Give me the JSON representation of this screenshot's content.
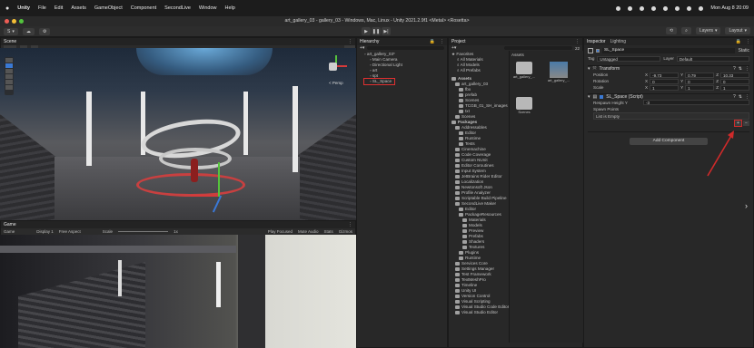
{
  "macos": {
    "app": "Unity",
    "menus": [
      "File",
      "Edit",
      "Assets",
      "GameObject",
      "Component",
      "SecondLive",
      "Window",
      "Help"
    ],
    "clock": "Mon Aug 8 20:09"
  },
  "window": {
    "title": "art_gallery_03 - gallery_03 - Windows, Mac, Linux - Unity 2021.2.9f1 <Metal> <Rosetta>"
  },
  "toolbar": {
    "account": "S",
    "layers": "Layers",
    "layout": "Layout"
  },
  "scene": {
    "tab": "Scene",
    "persp": "< Persp"
  },
  "game": {
    "tab": "Game",
    "mode": "Game",
    "display": "Display 1",
    "aspect": "Free Aspect",
    "scale_label": "Scale",
    "scale_value": "1x",
    "play_focused": "Play Focused",
    "mute": "Mute Audio",
    "stats": "Stats",
    "gizmos": "Gizmos"
  },
  "hierarchy": {
    "tab": "Hierarchy",
    "items": [
      {
        "label": "art_gallery_03*",
        "indent": 0
      },
      {
        "label": "Main Camera",
        "indent": 1
      },
      {
        "label": "Directional Light",
        "indent": 1
      },
      {
        "label": "art",
        "indent": 1
      },
      {
        "label": "spt",
        "indent": 1
      },
      {
        "label": "SL_Space",
        "indent": 1,
        "selected": true
      }
    ]
  },
  "project": {
    "tab": "Project",
    "favorites": {
      "label": "Favorites",
      "items": [
        "All Materials",
        "All Models",
        "All Prefabs"
      ]
    },
    "tree": [
      {
        "label": "Assets",
        "indent": 0,
        "bold": true
      },
      {
        "label": "art_gallery_03",
        "indent": 1
      },
      {
        "label": "fbx",
        "indent": 2
      },
      {
        "label": "prefab",
        "indent": 2
      },
      {
        "label": "Scenes",
        "indent": 2
      },
      {
        "label": "TCGB_01_SH_images",
        "indent": 2
      },
      {
        "label": "txt",
        "indent": 2
      },
      {
        "label": "Scenes",
        "indent": 1
      },
      {
        "label": "Packages",
        "indent": 0,
        "bold": true
      },
      {
        "label": "Addressables",
        "indent": 1
      },
      {
        "label": "Editor",
        "indent": 2
      },
      {
        "label": "Runtime",
        "indent": 2
      },
      {
        "label": "Tests",
        "indent": 2
      },
      {
        "label": "Cinemachine",
        "indent": 1
      },
      {
        "label": "Code Coverage",
        "indent": 1
      },
      {
        "label": "Custom NUnit",
        "indent": 1
      },
      {
        "label": "Editor Coroutines",
        "indent": 1
      },
      {
        "label": "Input System",
        "indent": 1
      },
      {
        "label": "JetBrains Rider Editor",
        "indent": 1
      },
      {
        "label": "Localization",
        "indent": 1
      },
      {
        "label": "Newtonsoft Json",
        "indent": 1
      },
      {
        "label": "Profile Analyzer",
        "indent": 1
      },
      {
        "label": "Scriptable Build Pipeline",
        "indent": 1
      },
      {
        "label": "SecondLive Maker",
        "indent": 1
      },
      {
        "label": "Editor",
        "indent": 2
      },
      {
        "label": "PackageResources",
        "indent": 2
      },
      {
        "label": "Materials",
        "indent": 3
      },
      {
        "label": "Models",
        "indent": 3
      },
      {
        "label": "Preview",
        "indent": 3
      },
      {
        "label": "Prefabs",
        "indent": 3
      },
      {
        "label": "Shaders",
        "indent": 3
      },
      {
        "label": "Textures",
        "indent": 3
      },
      {
        "label": "Plugins",
        "indent": 2
      },
      {
        "label": "Runtime",
        "indent": 2
      },
      {
        "label": "Services Core",
        "indent": 1
      },
      {
        "label": "Settings Manager",
        "indent": 1
      },
      {
        "label": "Test Framework",
        "indent": 1
      },
      {
        "label": "TextMeshPro",
        "indent": 1
      },
      {
        "label": "Timeline",
        "indent": 1
      },
      {
        "label": "Unity UI",
        "indent": 1
      },
      {
        "label": "Version Control",
        "indent": 1
      },
      {
        "label": "Visual Scripting",
        "indent": 1
      },
      {
        "label": "Visual Studio Code Editor",
        "indent": 1
      },
      {
        "label": "Visual Studio Editor",
        "indent": 1
      }
    ],
    "assets_header": "Assets",
    "grid": [
      {
        "label": "art_gallery_...",
        "kind": "folder"
      },
      {
        "label": "art_gallery_...",
        "kind": "scene"
      },
      {
        "label": "Scenes",
        "kind": "folder"
      }
    ],
    "count": "22"
  },
  "inspector": {
    "tabs": [
      "Inspector",
      "Lighting"
    ],
    "object_name": "SL_Space",
    "static": "Static",
    "tag_label": "Tag",
    "tag": "Untagged",
    "layer_label": "Layer",
    "layer": "Default",
    "transform": {
      "title": "Transform",
      "position": {
        "label": "Position",
        "x": "-9.73",
        "y": "0.79",
        "z": "10.33"
      },
      "rotation": {
        "label": "Rotation",
        "x": "0",
        "y": "0",
        "z": "0"
      },
      "scale": {
        "label": "Scale",
        "x": "1",
        "y": "1",
        "z": "1"
      }
    },
    "script": {
      "title": "SL_Space (Script)",
      "respawn_label": "Respawn Height Y",
      "respawn_value": "-3",
      "spawn_label": "Spawn Points",
      "list_empty": "List is Empty"
    },
    "add_component": "Add Component"
  },
  "colors": {
    "accent": "#3a79d4",
    "selected_outline": "#e03030",
    "arrow": "#d02a2a"
  }
}
